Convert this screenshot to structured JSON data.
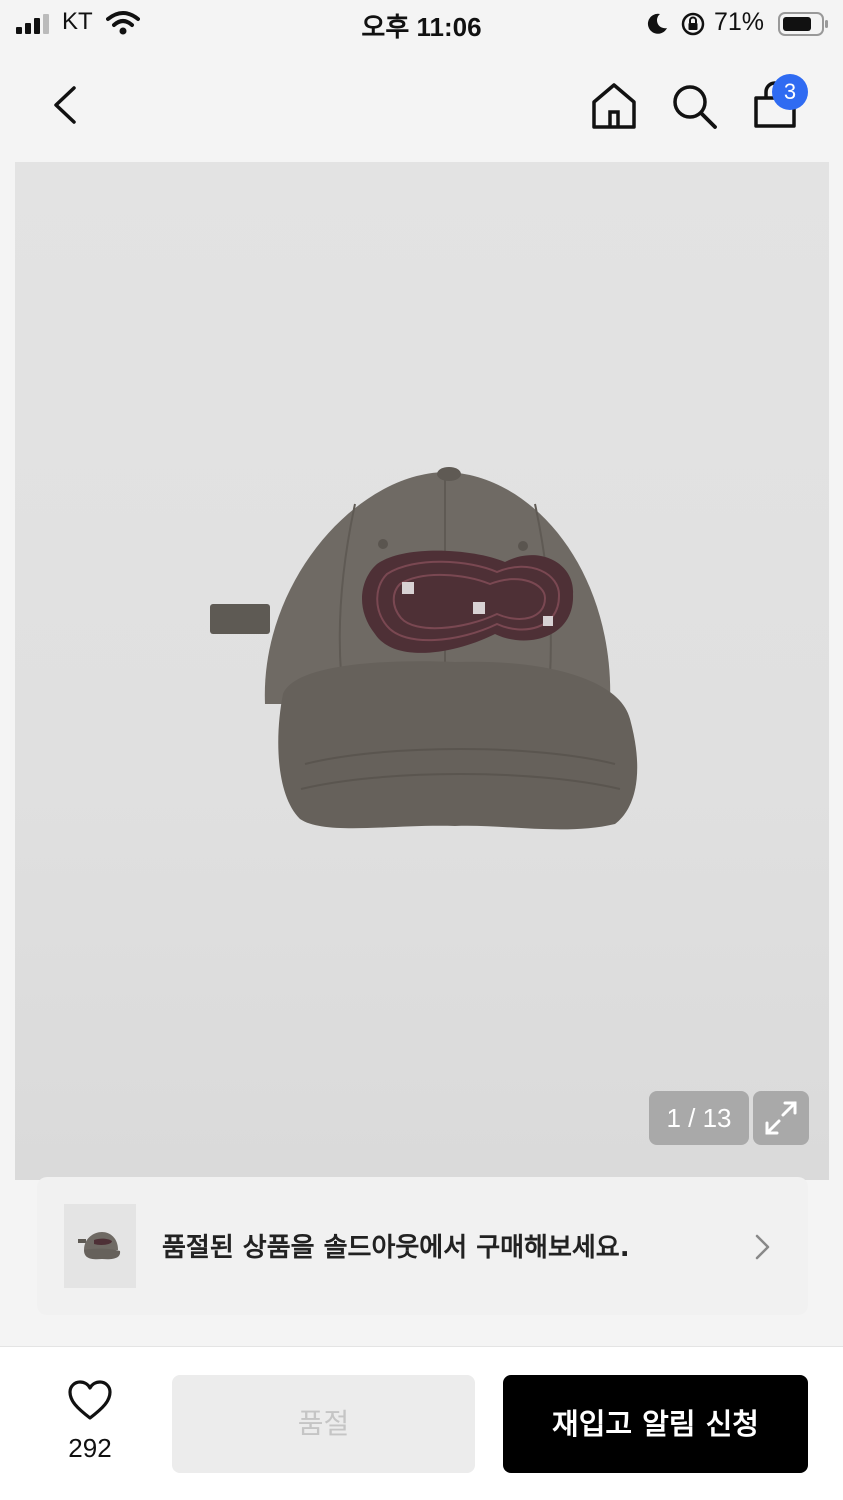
{
  "status_bar": {
    "carrier": "KT",
    "time": "오후 11:06",
    "battery": "71%",
    "icons": [
      "signal-icon",
      "wifi-icon",
      "moon-icon",
      "rotation-lock-icon",
      "battery-icon"
    ]
  },
  "nav": {
    "icons": [
      "back-arrow-icon",
      "home-icon",
      "search-icon",
      "shopping-bag-icon"
    ],
    "cart_count": "3"
  },
  "product_image": {
    "pager": "1 / 13",
    "expand_icon": "expand-icon"
  },
  "soldout_banner": {
    "text": "품절된 상품을 솔드아웃에서 구매해보세요.",
    "icon": "chevron-right-icon"
  },
  "bottom_bar": {
    "like_icon": "heart-icon",
    "like_count": "292",
    "soldout_label": "품절",
    "restock_label": "재입고 알림 신청"
  },
  "colors": {
    "badge": "#2f6bf2",
    "primary_button": "#000000",
    "disabled_button": "#ececec"
  }
}
